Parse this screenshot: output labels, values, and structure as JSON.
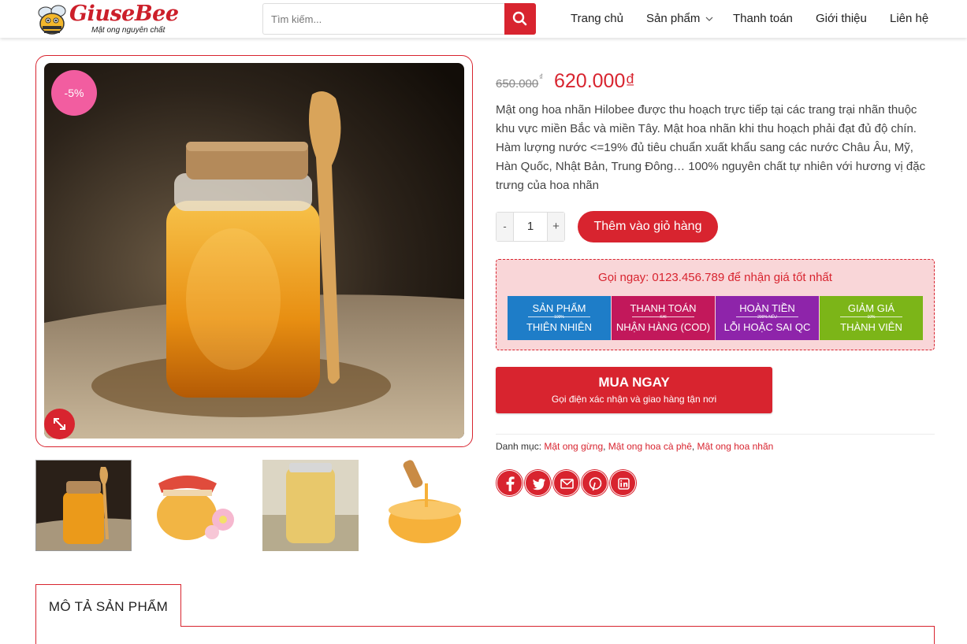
{
  "header": {
    "logo_text": "GiuseBee",
    "logo_tagline": "Mật ong nguyên chất",
    "search": {
      "placeholder": "Tìm kiếm..."
    },
    "nav": [
      {
        "label": "Trang chủ"
      },
      {
        "label": "Sản phẩm"
      },
      {
        "label": "Thanh toán"
      },
      {
        "label": "Giới thiệu"
      },
      {
        "label": "Liên hệ"
      }
    ]
  },
  "gallery": {
    "discount_badge": "-5%",
    "thumbnails_count": 4
  },
  "product": {
    "old_price": "650.000",
    "old_price_currency": "₫",
    "new_price": "620.000₫",
    "description": "Mật ong hoa nhãn Hilobee được thu hoạch trực tiếp tại các trang trại nhãn thuộc khu vực miền Bắc và miền Tây. Mật hoa nhãn khi thu hoạch phải đạt đủ độ chín. Hàm lượng nước <=19% đủ tiêu chuẩn xuất khẩu sang các nước Châu Âu, Mỹ, Hàn Quốc, Nhật Bản, Trung Đông… 100% nguyên chất tự nhiên với hương vị đặc trưng của hoa nhãn",
    "quantity": {
      "minus": "-",
      "value": "1",
      "plus": "+"
    },
    "add_to_cart": "Thêm vào giỏ hàng"
  },
  "promo": {
    "call_text": "Gọi ngay: 0123.456.789 để nhận giá tốt nhất",
    "benefits": [
      {
        "top": "SẢN PHẨM",
        "mid": "100%",
        "bottom": "THIÊN NHIÊN",
        "color": "#1e7dc8"
      },
      {
        "top": "THANH TOÁN",
        "mid": "KHI",
        "bottom": "NHẬN HÀNG (COD)",
        "color": "#c2185b"
      },
      {
        "top": "HOÀN TIỀN",
        "mid": "200% NẾU",
        "bottom": "LỖI HOẶC SAI QC",
        "color": "#8e24aa"
      },
      {
        "top": "GIẢM GIÁ",
        "mid": "10%",
        "bottom": "THÀNH VIÊN",
        "color": "#7cb518"
      }
    ]
  },
  "buy_now": {
    "title": "MUA NGAY",
    "subtitle": "Gọi điện xác nhận và giao hàng tận nơi"
  },
  "categories": {
    "label": "Danh mục:",
    "items": [
      "Mật ong gừng",
      "Mật ong hoa cà phê",
      "Mật ong hoa nhãn"
    ]
  },
  "share_icons": [
    "facebook-icon",
    "twitter-icon",
    "email-icon",
    "pinterest-icon",
    "linkedin-icon"
  ],
  "tabs": {
    "description_tab": "MÔ TẢ SẢN PHẨM"
  },
  "colors": {
    "accent": "#d8242f",
    "badge": "#f25da0",
    "promo_bg": "#f9d6d8"
  }
}
